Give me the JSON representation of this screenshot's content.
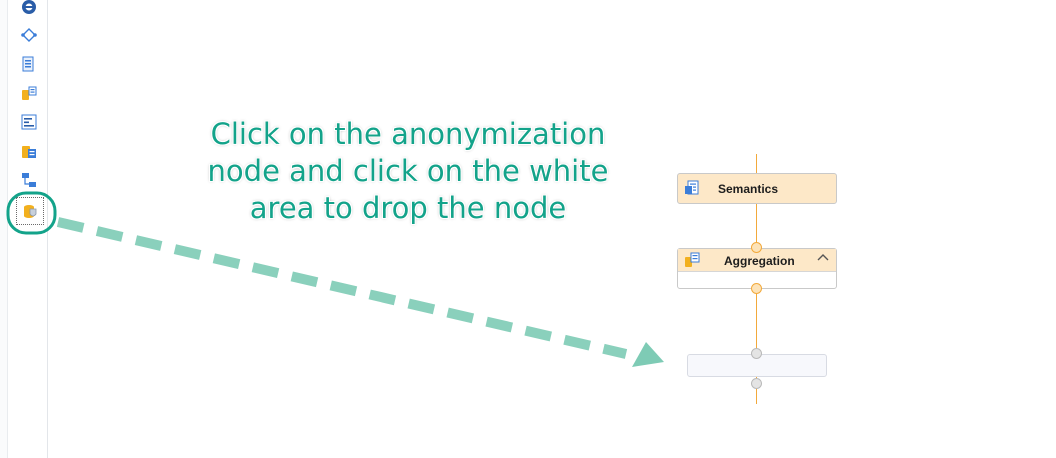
{
  "toolbar": {
    "tools": [
      {
        "icon": "union-node-icon"
      },
      {
        "icon": "join-node-icon"
      },
      {
        "icon": "projection-node-icon"
      },
      {
        "icon": "aggregation-node-icon"
      },
      {
        "icon": "rank-node-icon"
      },
      {
        "icon": "table-function-node-icon"
      },
      {
        "icon": "hierarchy-node-icon"
      },
      {
        "icon": "anonymization-node-icon",
        "selected": true
      }
    ]
  },
  "canvas": {
    "nodes": {
      "semantics": {
        "label": "Semantics",
        "icon": "semantics-icon"
      },
      "aggregation": {
        "label": "Aggregation",
        "icon": "aggregation-node-icon",
        "collapse_icon": "chevron-up-icon"
      }
    },
    "drop_zone": {
      "label": ""
    }
  },
  "annotation": {
    "lines": [
      "Click on the anonymization",
      "node and click on the white",
      "area to drop the node"
    ],
    "color": "#13a38a"
  },
  "colors": {
    "node_header": "#fde8c8",
    "flow_line": "#f2a93b",
    "annotation": "#13a38a"
  }
}
